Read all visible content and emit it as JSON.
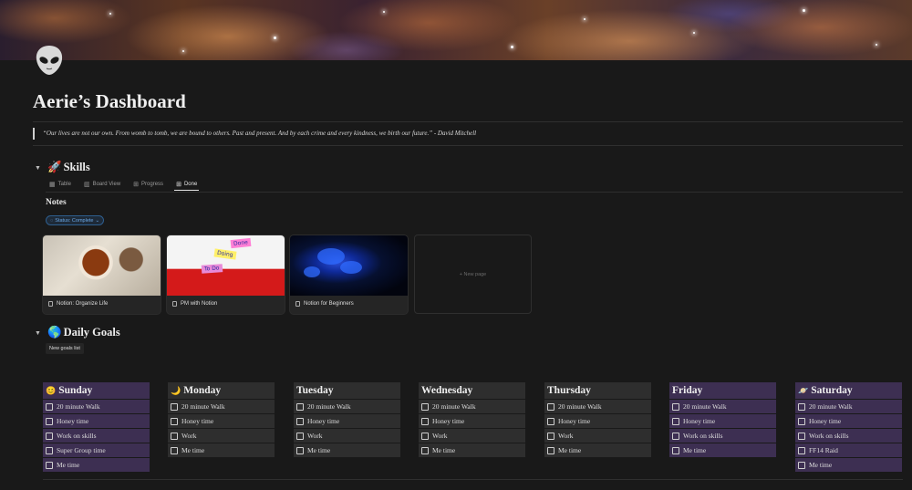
{
  "cover": {
    "description_icon": "galaxy-cover"
  },
  "page": {
    "icon": "alien-icon",
    "title": "Aerie’s Dashboard",
    "quote": "“Our lives are not our own.  From womb to tomb, we are bound to others.  Past and present.  And by each crime and every kindness, we birth our future.” - David Mitchell"
  },
  "skills": {
    "emoji": "🚀",
    "heading": "Skills",
    "tabs": [
      {
        "label": "Table",
        "icon": "table-icon"
      },
      {
        "label": "Board View",
        "icon": "board-icon"
      },
      {
        "label": "Progress",
        "icon": "gallery-icon"
      },
      {
        "label": "Done",
        "icon": "gallery-icon"
      }
    ],
    "notes_label": "Notes",
    "filter": "Status: Complete",
    "cards": [
      {
        "title": "Notion: Organize Life"
      },
      {
        "title": "PM with Notion"
      },
      {
        "title": "Notion for Beginners"
      }
    ],
    "new_page": "+ New page",
    "stickies": {
      "a": "Done",
      "b": "Doing",
      "c": "To Do"
    }
  },
  "daily": {
    "emoji": "🌎",
    "heading": "Daily Goals",
    "new_button": "New goals list",
    "days": [
      {
        "name": "Sunday",
        "emoji": "😊",
        "color": "purple",
        "tasks": [
          "20 minute Walk",
          "Honey time",
          "Work on skills",
          "Super Group time",
          "Me time"
        ]
      },
      {
        "name": "Monday",
        "emoji": "🌙",
        "color": "gray",
        "tasks": [
          "20 minute Walk",
          "Honey time",
          "Work",
          "Me time"
        ]
      },
      {
        "name": "Tuesday",
        "emoji": "",
        "color": "gray",
        "tasks": [
          "20 minute Walk",
          "Honey time",
          "Work",
          "Me time"
        ]
      },
      {
        "name": "Wednesday",
        "emoji": "",
        "color": "gray",
        "tasks": [
          "20 minute Walk",
          "Honey time",
          "Work",
          "Me time"
        ]
      },
      {
        "name": "Thursday",
        "emoji": "",
        "color": "gray",
        "tasks": [
          "20 minute Walk",
          "Honey time",
          "Work",
          "Me time"
        ]
      },
      {
        "name": "Friday",
        "emoji": "",
        "color": "purple",
        "tasks": [
          "20 minute Walk",
          "Honey time",
          "Work on skills",
          "Me time"
        ]
      },
      {
        "name": "Saturday",
        "emoji": "🪐",
        "color": "purple",
        "tasks": [
          "20 minute Walk",
          "Honey time",
          "Work on skills",
          "FF14 Raid",
          "Me time"
        ]
      }
    ]
  },
  "colors": {
    "background": "#191919",
    "purple": "#3d2f52",
    "gray": "#2e2e2e",
    "accent_blue": "#6aa8e6"
  }
}
